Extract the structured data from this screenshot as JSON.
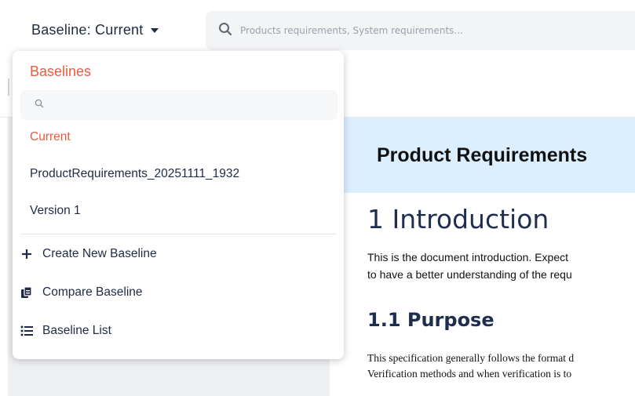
{
  "topbar": {
    "baseline_label": "Baseline: Current",
    "search_placeholder": "Products requirements, System requirements..."
  },
  "dropdown": {
    "title": "Baselines",
    "search_placeholder": "",
    "baselines": [
      {
        "label": "Current",
        "active": true
      },
      {
        "label": "ProductRequirements_20251111_1932",
        "active": false
      },
      {
        "label": "Version 1",
        "active": false
      }
    ],
    "actions": {
      "create": "Create New Baseline",
      "compare": "Compare Baseline",
      "list": "Baseline List"
    }
  },
  "document": {
    "header_title": "Product Requirements",
    "section1_heading": "1  Introduction",
    "section1_line1": "This is the document introduction. Expect",
    "section1_line2": "to have a better understanding of the requ",
    "section11_heading": "1.1  Purpose",
    "section11_line1": "This specification generally follows the format d",
    "section11_line2": "Verification methods and when verification is to"
  },
  "colors": {
    "accent": "#ef5a3f",
    "text_dark": "#1f2a44",
    "doc_header_bg": "#dcefff",
    "left_panel_bg": "#eef0f3"
  },
  "icons": [
    "chevron-down-icon",
    "search-icon",
    "plus-icon",
    "compare-icon",
    "list-icon"
  ]
}
